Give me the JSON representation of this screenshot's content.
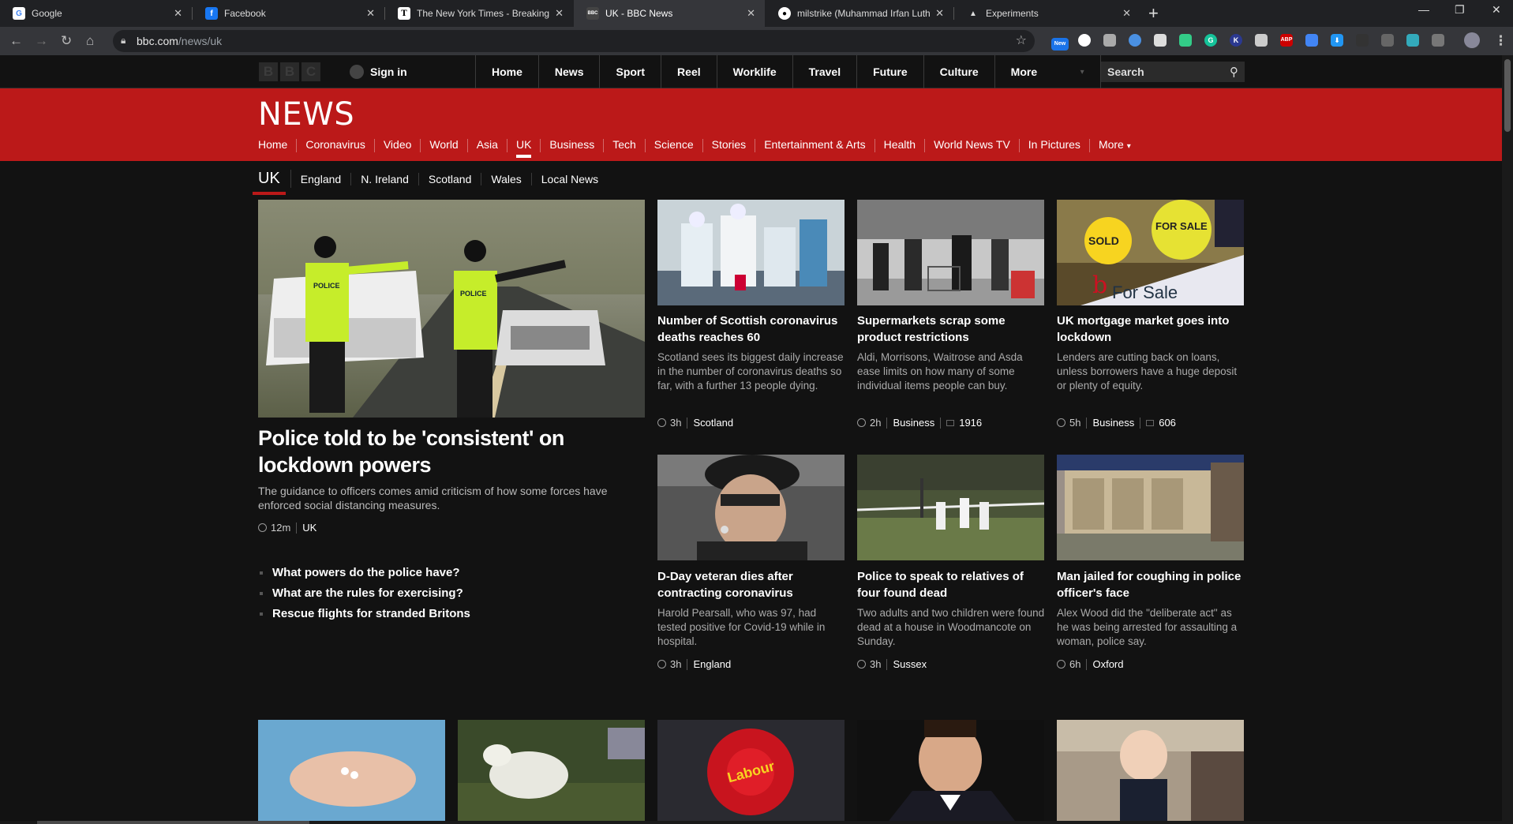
{
  "browser": {
    "tabs": [
      {
        "title": "Google"
      },
      {
        "title": "Facebook"
      },
      {
        "title": "The New York Times - Breaking N"
      },
      {
        "title": "UK - BBC News"
      },
      {
        "title": "milstrike (Muhammad Irfan Luthf"
      },
      {
        "title": "Experiments"
      }
    ],
    "url_host": "bbc.com",
    "url_path": "/news/uk",
    "ext_badge": "New"
  },
  "bbc_bar": {
    "logo_letters": [
      "B",
      "B",
      "C"
    ],
    "sign_in": "Sign in",
    "nav": [
      "Home",
      "News",
      "Sport",
      "Reel",
      "Worklife",
      "Travel",
      "Future",
      "Culture"
    ],
    "more": "More",
    "search_placeholder": "Search"
  },
  "news_bar": {
    "logo": "NEWS",
    "nav": [
      "Home",
      "Coronavirus",
      "Video",
      "World",
      "Asia",
      "UK",
      "Business",
      "Tech",
      "Science",
      "Stories",
      "Entertainment & Arts",
      "Health",
      "World News TV",
      "In Pictures",
      "More"
    ],
    "more_arrow": "▾"
  },
  "sub_nav": {
    "title": "UK",
    "items": [
      "England",
      "N. Ireland",
      "Scotland",
      "Wales",
      "Local News"
    ]
  },
  "lead": {
    "title": "Police told to be 'consistent' on lockdown powers",
    "summary": "The guidance to officers comes amid criticism of how some forces have enforced social distancing measures.",
    "time": "12m",
    "tag": "UK",
    "related": [
      "What powers do the police have?",
      "What are the rules for exercising?",
      "Rescue flights for stranded Britons"
    ]
  },
  "stories": [
    {
      "title": "Number of Scottish coronavirus deaths reaches 60",
      "summary": "Scotland sees its biggest daily increase in the number of coronavirus deaths so far, with a further 13 people dying.",
      "time": "3h",
      "tag": "Scotland",
      "comments": ""
    },
    {
      "title": "Supermarkets scrap some product restrictions",
      "summary": "Aldi, Morrisons, Waitrose and Asda ease limits on how many of some individual items people can buy.",
      "time": "2h",
      "tag": "Business",
      "comments": "1916"
    },
    {
      "title": "UK mortgage market goes into lockdown",
      "summary": "Lenders are cutting back on loans, unless borrowers have a huge deposit or plenty of equity.",
      "time": "5h",
      "tag": "Business",
      "comments": "606"
    },
    {
      "title": "D-Day veteran dies after contracting coronavirus",
      "summary": "Harold Pearsall, who was 97, had tested positive for Covid-19 while in hospital.",
      "time": "3h",
      "tag": "England",
      "comments": ""
    },
    {
      "title": "Police to speak to relatives of four found dead",
      "summary": "Two adults and two children were found dead at a house in Woodmancote on Sunday.",
      "time": "3h",
      "tag": "Sussex",
      "comments": ""
    },
    {
      "title": "Man jailed for coughing in police officer's face",
      "summary": "Alex Wood did the \"deliberate act\" as he was being arrested for assaulting a woman, police say.",
      "time": "6h",
      "tag": "Oxford",
      "comments": ""
    }
  ],
  "image_text": {
    "sold_sign": "SOLD",
    "for_sale_sign": "FOR SALE",
    "board_text": "For Sale",
    "police_vest": "POLICE",
    "rosette": "Labour"
  }
}
